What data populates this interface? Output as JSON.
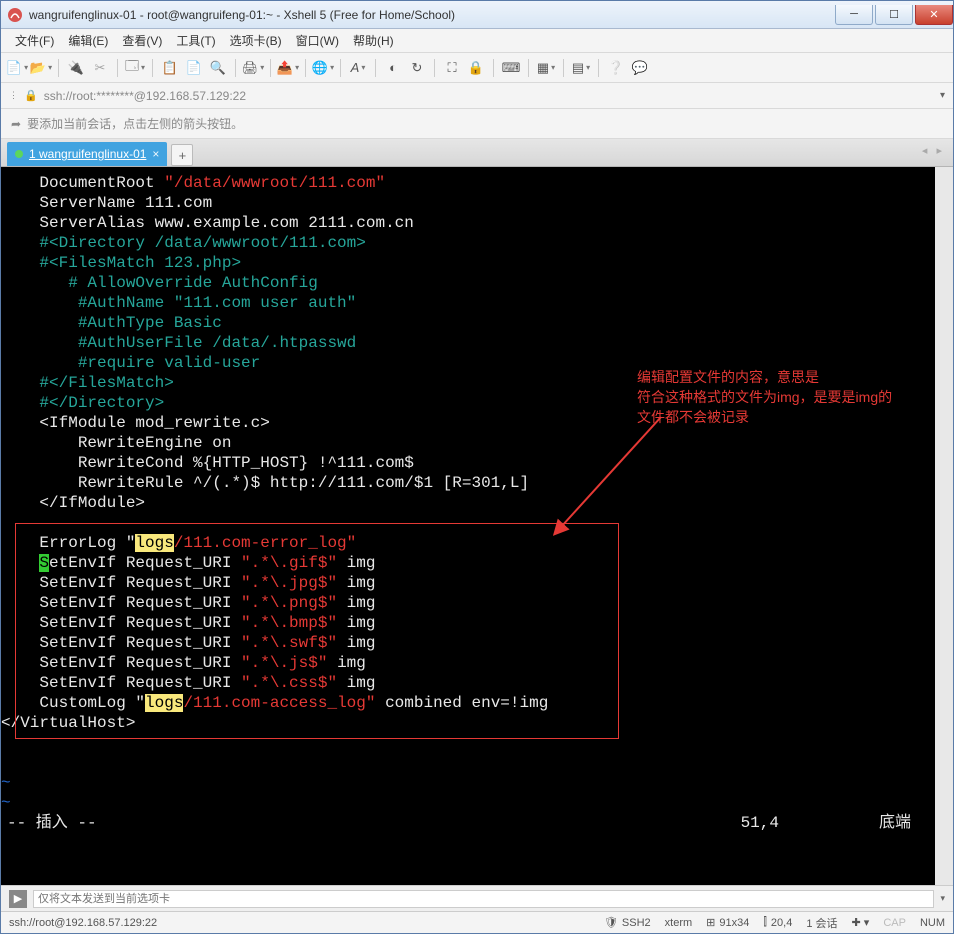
{
  "window": {
    "title": "wangruifenglinux-01 - root@wangruifeng-01:~ - Xshell 5 (Free for Home/School)"
  },
  "menu": {
    "file": "文件(F)",
    "edit": "编辑(E)",
    "view": "查看(V)",
    "tools": "工具(T)",
    "tab": "选项卡(B)",
    "window": "窗口(W)",
    "help": "帮助(H)"
  },
  "addressbar": {
    "text": "ssh://root:********@192.168.57.129:22"
  },
  "hintbar": {
    "text": "要添加当前会话，点击左侧的箭头按钮。"
  },
  "tab": {
    "label": "1 wangruifenglinux-01"
  },
  "annotation": {
    "l1": "编辑配置文件的内容，意思是",
    "l2": "符合这种格式的文件为img，是要是img的",
    "l3": "文件都不会被记录"
  },
  "term": {
    "l1a": "    DocumentRoot ",
    "l1b": "\"/data/wwwroot/111.com\"",
    "l2": "    ServerName 111.com",
    "l3": "    ServerAlias www.example.com 2111.com.cn",
    "l4": "    #<Directory /data/wwwroot/111.com>",
    "l5": "    #<FilesMatch 123.php>",
    "l6": "       # AllowOverride AuthConfig",
    "l7": "        #AuthName \"111.com user auth\"",
    "l8": "        #AuthType Basic",
    "l9": "        #AuthUserFile /data/.htpasswd",
    "l10": "        #require valid-user",
    "l11": "    #</FilesMatch>",
    "l12": "    #</Directory>",
    "l13": "    <IfModule mod_rewrite.c>",
    "l14": "        RewriteEngine on",
    "l15": "        RewriteCond %{HTTP_HOST} !^111.com$",
    "l16": "        RewriteRule ^/(.*)$ http://111.com/$1 [R=301,L]",
    "l17": "    </IfModule>",
    "l19a": "    ErrorLog \"",
    "l19hl": "logs",
    "l19b": "/111.com-error_log\"",
    "l20a": "    ",
    "l20c": "S",
    "l20r": "etEnvIf Request_URI ",
    "l20p": "\".*\\.gif$\"",
    "l20e": " img",
    "l21a": "    SetEnvIf Request_URI ",
    "l21p": "\".*\\.jpg$\"",
    "l21e": " img",
    "l22a": "    SetEnvIf Request_URI ",
    "l22p": "\".*\\.png$\"",
    "l22e": " img",
    "l23a": "    SetEnvIf Request_URI ",
    "l23p": "\".*\\.bmp$\"",
    "l23e": " img",
    "l24a": "    SetEnvIf Request_URI ",
    "l24p": "\".*\\.swf$\"",
    "l24e": " img",
    "l25a": "    SetEnvIf Request_URI ",
    "l25p": "\".*\\.js$\"",
    "l25e": " img",
    "l26a": "    SetEnvIf Request_URI ",
    "l26p": "\".*\\.css$\"",
    "l26e": " img",
    "l27a": "    CustomLog \"",
    "l27hl": "logs",
    "l27b": "/111.com-access_log\"",
    "l27e": " combined env=!img",
    "l28": "</VirtualHost>",
    "tilde": "~",
    "mode": "-- 插入 --",
    "pos": "51,4",
    "loc": "底端"
  },
  "sendbar": {
    "placeholder": "仅将文本发送到当前选项卡"
  },
  "status": {
    "conn": "ssh://root@192.168.57.129:22",
    "proto": "SSH2",
    "termtype": "xterm",
    "size": "91x34",
    "fs": "20,4",
    "sess": "1 会话",
    "cap": "CAP",
    "num": "NUM"
  }
}
